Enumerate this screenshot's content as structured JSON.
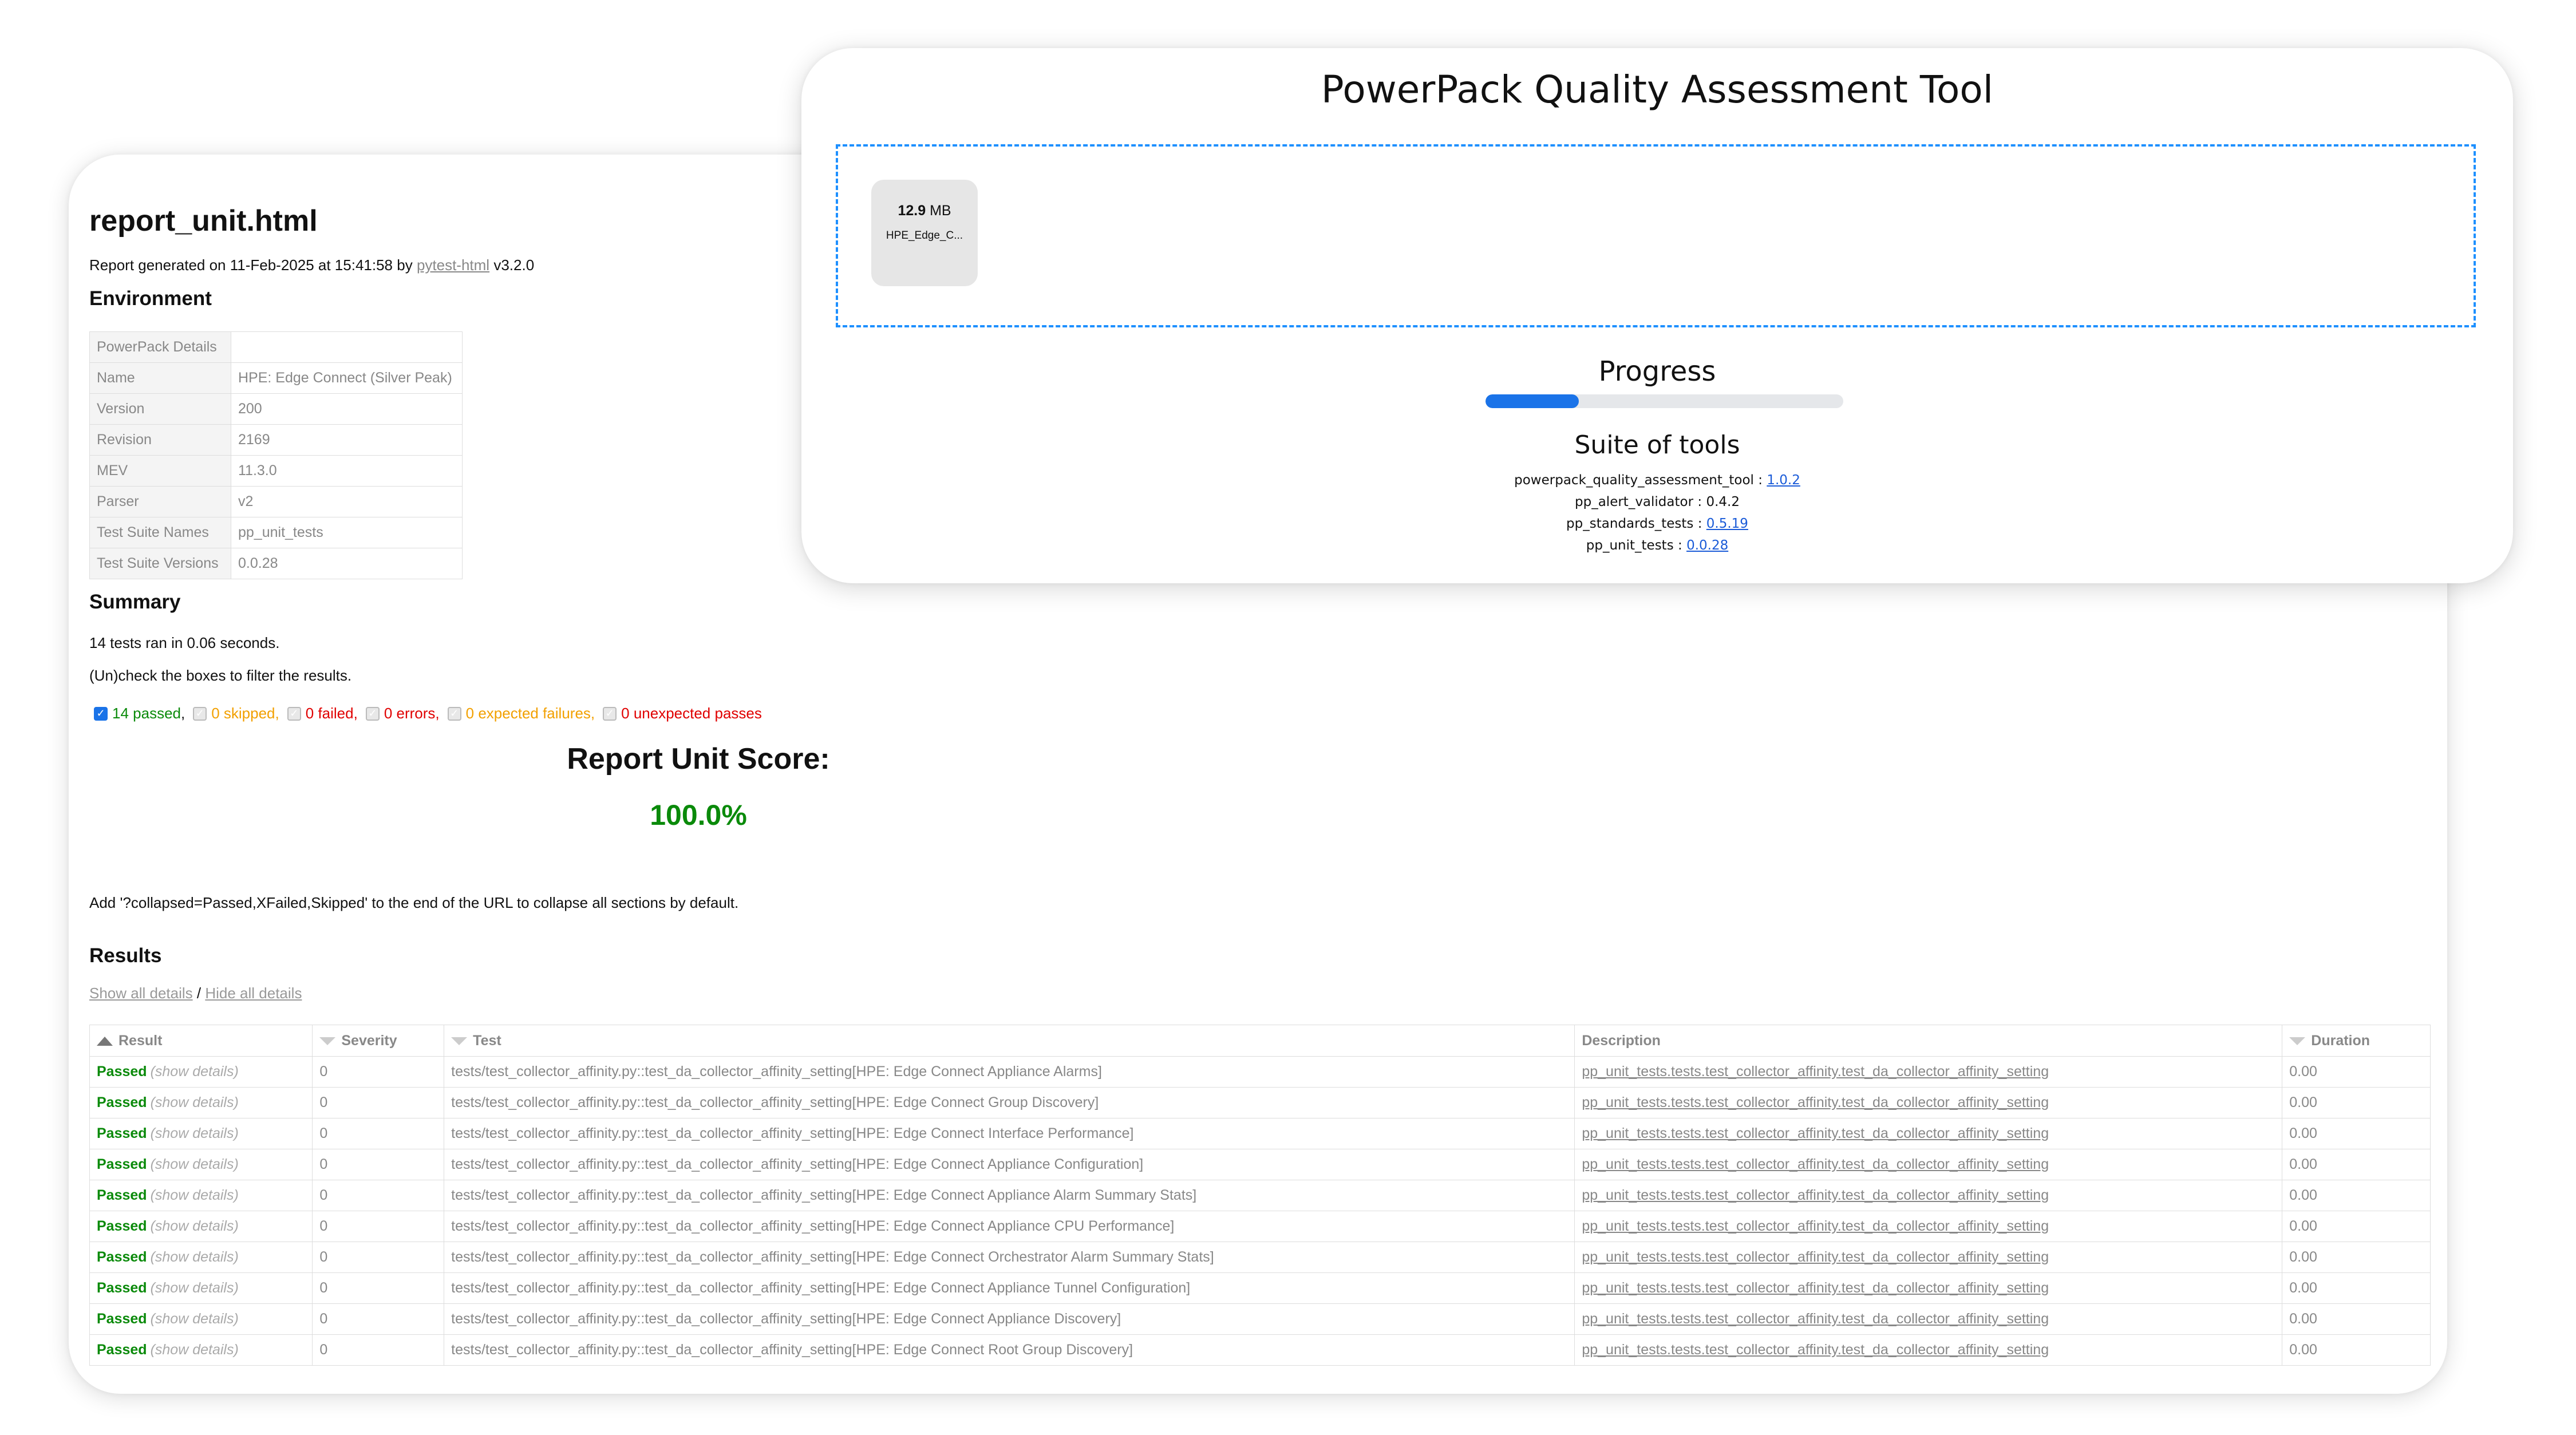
{
  "report": {
    "title": "report_unit.html",
    "generated_prefix": "Report generated on 11-Feb-2025 at 15:41:58 by",
    "generated_link": "pytest-html",
    "generated_suffix": "v3.2.0",
    "environment_heading": "Environment",
    "environment": [
      {
        "key": "PowerPack Details",
        "value": ""
      },
      {
        "key": "Name",
        "value": "HPE: Edge Connect (Silver Peak)"
      },
      {
        "key": "Version",
        "value": "200"
      },
      {
        "key": "Revision",
        "value": "2169"
      },
      {
        "key": "MEV",
        "value": "11.3.0"
      },
      {
        "key": "Parser",
        "value": "v2"
      },
      {
        "key": "Test Suite Names",
        "value": "pp_unit_tests"
      },
      {
        "key": "Test Suite Versions",
        "value": "0.0.28"
      }
    ],
    "summary_heading": "Summary",
    "summary_line": "14 tests ran in 0.06 seconds.",
    "filter_hint": "(Un)check the boxes to filter the results.",
    "filters": [
      {
        "label": "14 passed",
        "checked": true
      },
      {
        "label": "0 skipped",
        "checked": false
      },
      {
        "label": "0 failed",
        "checked": false
      },
      {
        "label": "0 errors",
        "checked": false
      },
      {
        "label": "0 expected failures",
        "checked": false
      },
      {
        "label": "0 unexpected passes",
        "checked": false
      }
    ],
    "score_title": "Report Unit Score:",
    "score_value": "100.0%",
    "collapse_hint": "Add '?collapsed=Passed,XFailed,Skipped' to the end of the URL to collapse all sections by default.",
    "results_heading": "Results",
    "show_all": "Show all details",
    "separator": "/",
    "hide_all": "Hide all details",
    "columns": [
      "Result",
      "Severity",
      "Test",
      "Description",
      "Duration"
    ],
    "rows": [
      {
        "result": "Passed",
        "details": "(show details)",
        "severity": "0",
        "test": "tests/test_collector_affinity.py::test_da_collector_affinity_setting[HPE: Edge Connect Appliance Alarms]",
        "description": "pp_unit_tests.tests.test_collector_affinity.test_da_collector_affinity_setting",
        "duration": "0.00"
      },
      {
        "result": "Passed",
        "details": "(show details)",
        "severity": "0",
        "test": "tests/test_collector_affinity.py::test_da_collector_affinity_setting[HPE: Edge Connect Group Discovery]",
        "description": "pp_unit_tests.tests.test_collector_affinity.test_da_collector_affinity_setting",
        "duration": "0.00"
      },
      {
        "result": "Passed",
        "details": "(show details)",
        "severity": "0",
        "test": "tests/test_collector_affinity.py::test_da_collector_affinity_setting[HPE: Edge Connect Interface Performance]",
        "description": "pp_unit_tests.tests.test_collector_affinity.test_da_collector_affinity_setting",
        "duration": "0.00"
      },
      {
        "result": "Passed",
        "details": "(show details)",
        "severity": "0",
        "test": "tests/test_collector_affinity.py::test_da_collector_affinity_setting[HPE: Edge Connect Appliance Configuration]",
        "description": "pp_unit_tests.tests.test_collector_affinity.test_da_collector_affinity_setting",
        "duration": "0.00"
      },
      {
        "result": "Passed",
        "details": "(show details)",
        "severity": "0",
        "test": "tests/test_collector_affinity.py::test_da_collector_affinity_setting[HPE: Edge Connect Appliance Alarm Summary Stats]",
        "description": "pp_unit_tests.tests.test_collector_affinity.test_da_collector_affinity_setting",
        "duration": "0.00"
      },
      {
        "result": "Passed",
        "details": "(show details)",
        "severity": "0",
        "test": "tests/test_collector_affinity.py::test_da_collector_affinity_setting[HPE: Edge Connect Appliance CPU Performance]",
        "description": "pp_unit_tests.tests.test_collector_affinity.test_da_collector_affinity_setting",
        "duration": "0.00"
      },
      {
        "result": "Passed",
        "details": "(show details)",
        "severity": "0",
        "test": "tests/test_collector_affinity.py::test_da_collector_affinity_setting[HPE: Edge Connect Orchestrator Alarm Summary Stats]",
        "description": "pp_unit_tests.tests.test_collector_affinity.test_da_collector_affinity_setting",
        "duration": "0.00"
      },
      {
        "result": "Passed",
        "details": "(show details)",
        "severity": "0",
        "test": "tests/test_collector_affinity.py::test_da_collector_affinity_setting[HPE: Edge Connect Appliance Tunnel Configuration]",
        "description": "pp_unit_tests.tests.test_collector_affinity.test_da_collector_affinity_setting",
        "duration": "0.00"
      },
      {
        "result": "Passed",
        "details": "(show details)",
        "severity": "0",
        "test": "tests/test_collector_affinity.py::test_da_collector_affinity_setting[HPE: Edge Connect Appliance Discovery]",
        "description": "pp_unit_tests.tests.test_collector_affinity.test_da_collector_affinity_setting",
        "duration": "0.00"
      },
      {
        "result": "Passed",
        "details": "(show details)",
        "severity": "0",
        "test": "tests/test_collector_affinity.py::test_da_collector_affinity_setting[HPE: Edge Connect Root Group Discovery]",
        "description": "pp_unit_tests.tests.test_collector_affinity.test_da_collector_affinity_setting",
        "duration": "0.00"
      }
    ]
  },
  "tool": {
    "title": "PowerPack Quality Assessment Tool",
    "file_size_value": "12.9",
    "file_size_unit": "MB",
    "file_name": "HPE_Edge_C...",
    "progress_title": "Progress",
    "progress_fraction": 0.26,
    "suite_title": "Suite of tools",
    "suite": [
      {
        "name": "powerpack_quality_assessment_tool",
        "sep": " : ",
        "version": "1.0.2",
        "link": true
      },
      {
        "name": "pp_alert_validator",
        "sep": " : ",
        "version": "0.4.2",
        "link": false
      },
      {
        "name": "pp_standards_tests",
        "sep": " : ",
        "version": "0.5.19",
        "link": true
      },
      {
        "name": "pp_unit_tests",
        "sep": " : ",
        "version": "0.0.28",
        "link": true
      }
    ]
  },
  "colors": {
    "passed": "#0a8a0a",
    "warning": "#f2a000",
    "error": "#e00000",
    "accent": "#1a73e8",
    "dropzone_border": "#1e90ff"
  },
  "icons": [
    "checkbox-icon",
    "sort-up-icon",
    "sort-down-icon"
  ]
}
